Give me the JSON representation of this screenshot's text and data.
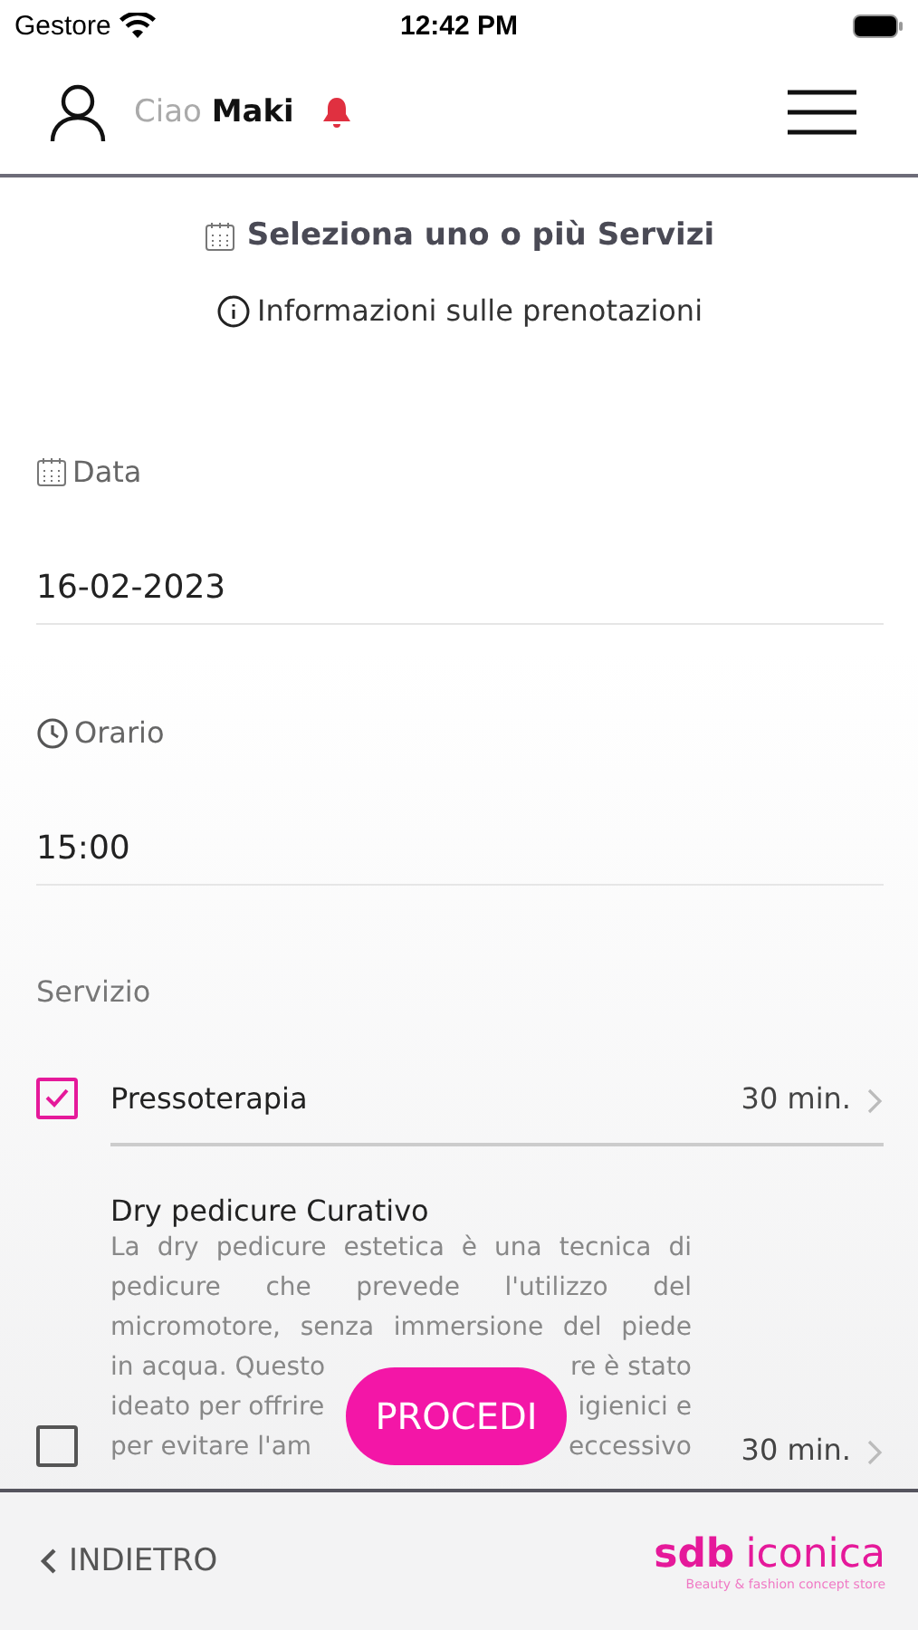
{
  "status_bar": {
    "carrier": "Gestore",
    "time": "12:42 PM"
  },
  "header": {
    "greeting": "Ciao",
    "user": "Maki"
  },
  "title": "Seleziona uno o più Servizi",
  "info_link": "Informazioni sulle prenotazioni",
  "fields": [
    {
      "kind": "date",
      "label": "Data",
      "value": "16-02-2023"
    },
    {
      "kind": "time",
      "label": "Orario",
      "value": "15:00"
    }
  ],
  "services_label": "Servizio",
  "services": [
    {
      "name": "Pressoterapia",
      "duration": "30 min.",
      "checked": true
    },
    {
      "name": "Dry pedicure Curativo",
      "duration": "30 min.",
      "checked": false,
      "description_lines": [
        {
          "left": "La dry pedicure estetica è una tecnica di"
        },
        {
          "left": "pedicure che prevede l'utilizzo del"
        },
        {
          "left": "micromotore, senza immersione del piede"
        },
        {
          "left": "in acqua. Questo",
          "right": "re è stato"
        },
        {
          "left": "ideato per offrire",
          "right": "igienici e"
        },
        {
          "left": "per evitare l'am",
          "right": "eccessivo"
        }
      ]
    }
  ],
  "proceed_button": "PROCEDI",
  "footer": {
    "back": "INDIETRO",
    "logo_mark": "sdb",
    "logo_name": "iconica",
    "logo_tagline": "Beauty & fashion concept store"
  }
}
